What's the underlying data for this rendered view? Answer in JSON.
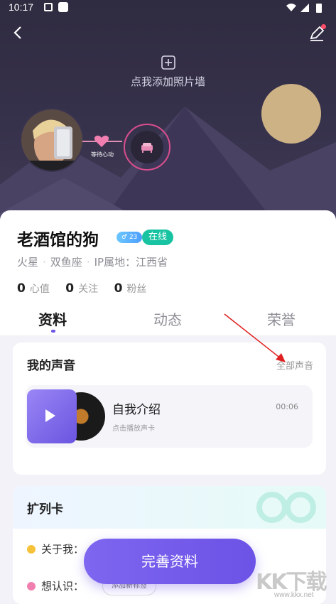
{
  "status_bar": {
    "time": "10:17"
  },
  "hero": {
    "add_photo_label": "点我添加照片墙",
    "link_label": "等待心动"
  },
  "profile": {
    "name": "老酒馆的狗",
    "level_badge": "23",
    "online_badge": "在线",
    "meta": [
      "火星",
      "双鱼座",
      "IP属地：江西省"
    ],
    "stats": [
      {
        "value": "0",
        "label": "心值"
      },
      {
        "value": "0",
        "label": "关注"
      },
      {
        "value": "0",
        "label": "粉丝"
      }
    ]
  },
  "tabs": [
    {
      "label": "资料",
      "active": true
    },
    {
      "label": "动态",
      "active": false
    },
    {
      "label": "荣誉",
      "active": false
    }
  ],
  "voice": {
    "title": "我的声音",
    "all_link": "全部声音",
    "card": {
      "name": "自我介绍",
      "subtitle": "点击播放声卡",
      "duration": "00:06"
    }
  },
  "ext_card": {
    "title": "扩列卡",
    "rows": [
      {
        "label": "关于我：",
        "icon": "smile-icon"
      },
      {
        "label": "想认识：",
        "icon": "heart-icon"
      }
    ],
    "add_tag_label": "添加新标签"
  },
  "primary_button": {
    "label": "完善资料"
  },
  "watermark": {
    "big": "KK下载",
    "small": "www.kkx.net"
  },
  "colors": {
    "accent": "#6c52e6",
    "online": "#18c3a1",
    "hero_bg": "#37324c",
    "arrow": "#e02020"
  }
}
